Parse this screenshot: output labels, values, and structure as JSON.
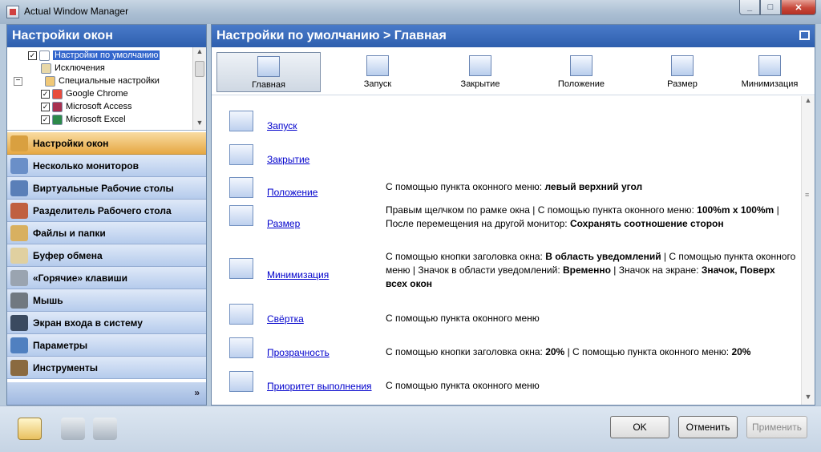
{
  "window": {
    "title": "Actual Window Manager",
    "min_glyph": "_",
    "max_glyph": "□",
    "close_glyph": "✕"
  },
  "left": {
    "title": "Настройки окон",
    "tree": [
      {
        "label": "Настройки по умолчанию",
        "checked": true,
        "selected": true
      },
      {
        "label": "Исключения"
      },
      {
        "label": "Специальные настройки",
        "expander": "−"
      },
      {
        "label": "Google Chrome",
        "checked": true
      },
      {
        "label": "Microsoft Access",
        "checked": true
      },
      {
        "label": "Microsoft Excel",
        "checked": true
      }
    ],
    "nav": [
      {
        "label": "Настройки окон",
        "active": true
      },
      {
        "label": "Несколько мониторов"
      },
      {
        "label": "Виртуальные Рабочие столы"
      },
      {
        "label": "Разделитель Рабочего стола"
      },
      {
        "label": "Файлы и папки"
      },
      {
        "label": "Буфер обмена"
      },
      {
        "label": "«Горячие» клавиши"
      },
      {
        "label": "Мышь"
      },
      {
        "label": "Экран входа в систему"
      },
      {
        "label": "Параметры"
      },
      {
        "label": "Инструменты"
      }
    ],
    "more_glyph": "»"
  },
  "right": {
    "title": "Настройки по умолчанию > Главная",
    "tabs": [
      "Главная",
      "Запуск",
      "Закрытие",
      "Положение",
      "Размер",
      "Минимизация"
    ],
    "rows": [
      {
        "link": "Запуск"
      },
      {
        "link": "Закрытие"
      },
      {
        "link": "Положение",
        "desc": [
          [
            "С помощью пункта оконного меню: ",
            false
          ],
          [
            "левый верхний угол",
            true
          ]
        ]
      },
      {
        "link": "Размер",
        "desc": [
          [
            "Правым щелчком по рамке окна | С помощью пункта оконного меню: ",
            false
          ],
          [
            "100%m x 100%m",
            true
          ],
          [
            " | После перемещения на другой монитор: ",
            false
          ],
          [
            "Сохранять соотношение сторон",
            true
          ]
        ]
      },
      {
        "link": "Минимизация",
        "desc": [
          [
            "С помощью кнопки заголовка окна: ",
            false
          ],
          [
            "В область уведомлений",
            true
          ],
          [
            " | С помощью пункта оконного меню | Значок в области уведомлений: ",
            false
          ],
          [
            "Временно",
            true
          ],
          [
            " | Значок на экране: ",
            false
          ],
          [
            "Значок, Поверх всех окон",
            true
          ]
        ]
      },
      {
        "link": "Свёртка",
        "desc": [
          [
            "С помощью пункта оконного меню",
            false
          ]
        ]
      },
      {
        "link": "Прозрачность",
        "desc": [
          [
            "С помощью кнопки заголовка окна: ",
            false
          ],
          [
            "20%",
            true
          ],
          [
            " | С помощью пункта оконного меню: ",
            false
          ],
          [
            "20%",
            true
          ]
        ]
      },
      {
        "link": "Приоритет выполнения",
        "desc": [
          [
            "С помощью пункта оконного меню",
            false
          ]
        ]
      }
    ]
  },
  "footer": {
    "ok": "OK",
    "cancel": "Отменить",
    "apply": "Применить"
  }
}
